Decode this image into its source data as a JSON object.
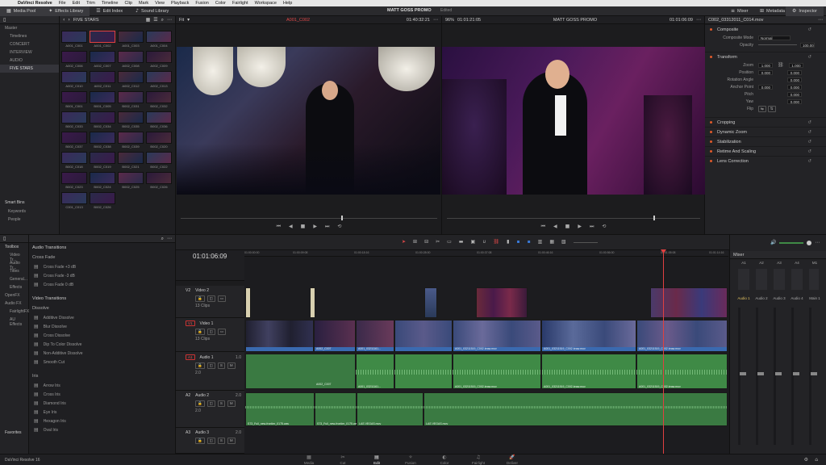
{
  "menubar": {
    "app": "DaVinci Resolve",
    "items": [
      "File",
      "Edit",
      "Trim",
      "Timeline",
      "Clip",
      "Mark",
      "View",
      "Playback",
      "Fusion",
      "Color",
      "Fairlight",
      "Workspace",
      "Help"
    ]
  },
  "toolbar": {
    "media_pool": "Media Pool",
    "effects_library": "Effects Library",
    "edit_index": "Edit Index",
    "sound_library": "Sound Library",
    "project_title": "MATT GOSS PROMO",
    "project_status": "Edited",
    "mixer": "Mixer",
    "metadata": "Metadata",
    "inspector": "Inspector"
  },
  "bins": {
    "header": "FIVE STARS",
    "master": "Master",
    "items": [
      "Timelines",
      "CONCERT",
      "INTERVIEW",
      "AUDIO",
      "FIVE STARS"
    ],
    "smart_bins": "Smart Bins",
    "smart_items": [
      "Keywords",
      "People"
    ]
  },
  "clips": [
    "A001_C001",
    "A001_C002",
    "A001_C003",
    "A001_C004",
    "A002_C006",
    "A002_C007",
    "A002_C008",
    "A002_C009",
    "A002_C010",
    "A002_C011",
    "A002_C012",
    "A002_C013",
    "B001_C001",
    "B001_C005",
    "B002_C031",
    "B002_C032",
    "B002_C033",
    "B002_C034",
    "B002_C035",
    "B002_C036",
    "B002_C037",
    "B002_C038",
    "B002_C039",
    "B002_C020",
    "B002_C018",
    "B002_C019",
    "B002_C021",
    "B002_C022",
    "B002_C023",
    "B002_C024",
    "B002_C025",
    "B002_C026",
    "C001_C013",
    "B002_C026"
  ],
  "source_viewer": {
    "zoom": "Fit",
    "clip": "A001_C002",
    "timecode": "01:40:32:21"
  },
  "timeline_viewer": {
    "zoom": "96%",
    "title": "MATT GOSS PROMO",
    "timecode": "01:01:21:05",
    "timecode2": "01:01:06:09"
  },
  "inspector": {
    "clip_name": "C002_03312011_C014.mov",
    "composite": "Composite",
    "composite_mode_label": "Composite Mode",
    "composite_mode": "Normal",
    "opacity_label": "Opacity",
    "opacity": "100.00",
    "transform": "Transform",
    "zoom_label": "Zoom",
    "zoom_x": "1.000",
    "zoom_y": "1.000",
    "position_label": "Position",
    "pos_x": "0.000",
    "pos_y": "0.000",
    "rotation_label": "Rotation Angle",
    "rotation": "0.000",
    "anchor_label": "Anchor Point",
    "anchor_x": "0.000",
    "anchor_y": "0.000",
    "pitch_label": "Pitch",
    "pitch": "0.000",
    "yaw_label": "Yaw",
    "yaw": "0.000",
    "flip_label": "Flip",
    "sections": [
      "Cropping",
      "Dynamic Zoom",
      "Stabilization",
      "Retime And Scaling",
      "Lens Correction"
    ]
  },
  "effects": {
    "toolbox": "Toolbox",
    "toolbox_items": [
      "Video Tr...",
      "Audio Tr...",
      "Titles",
      "General...",
      "Effects",
      "OpenFX",
      "Audio FX",
      "FairlightFX",
      "AU Effects"
    ],
    "audio_transitions": "Audio Transitions",
    "cross_fade": "Cross Fade",
    "audio_items": [
      "Cross Fade +3 dB",
      "Cross Fade -3 dB",
      "Cross Fade 0 dB"
    ],
    "video_transitions": "Video Transitions",
    "dissolve": "Dissolve",
    "video_items": [
      "Additive Dissolve",
      "Blur Dissolve",
      "Cross Dissolve",
      "Dip To Color Dissolve",
      "Non-Additive Dissolve",
      "Smooth Cut"
    ],
    "iris": "Iris",
    "iris_items": [
      "Arrow Iris",
      "Cross Iris",
      "Diamond Iris",
      "Eye Iris",
      "Hexagon Iris",
      "Oval Iris"
    ],
    "favorites": "Favorites"
  },
  "timeline": {
    "timecode": "01:01:06:09",
    "ruler": [
      "01:00:00:00",
      "01:00:09:08",
      "01:00:18:16",
      "01:00:28:00",
      "01:00:37:08",
      "01:00:46:16",
      "01:00:56:00",
      "01:01:05:08",
      "01:01:14:16"
    ],
    "tracks": [
      {
        "id": "V2",
        "name": "Video 2",
        "info": "13 Clips"
      },
      {
        "id": "V1",
        "name": "Video 1",
        "info": "13 Clips"
      },
      {
        "id": "A1",
        "name": "Audio 1",
        "info": "2.0",
        "ch": "1.0"
      },
      {
        "id": "A2",
        "name": "Audio 2",
        "info": "2.0",
        "ch": "2.0"
      },
      {
        "id": "A3",
        "name": "Audio 3",
        "info": "2.0",
        "ch": "2.0"
      }
    ],
    "v1_labels": [
      "A002_C007",
      "A001_03211161...",
      "A001_03211519_C002.braw.mov",
      "A001_03211519_C002.braw.mov",
      "A001_03211519_C002.braw.mov"
    ],
    "a1_labels": [
      "A002_C007",
      "A001_03211161...",
      "A001_03211519_C002.braw.mov",
      "A001_03211519_C002.braw.mov",
      "A001_03211519_C002.braw.mov"
    ],
    "a2_labels": [
      "S73_Full_new-frontier_0175.wav",
      "S73_Full_new-frontier_0175.wav",
      "LAS VEGAS.mov",
      "LAS VEGAS.mov"
    ]
  },
  "mixer": {
    "title": "Mixer",
    "channels": [
      "A1",
      "A2",
      "A3",
      "A4",
      "M1"
    ],
    "strips": [
      "Audio 1",
      "Audio 2",
      "Audio 3",
      "Audio 4",
      "Main 1"
    ]
  },
  "pages": {
    "items": [
      "Media",
      "Cut",
      "Edit",
      "Fusion",
      "Color",
      "Fairlight",
      "Deliver"
    ],
    "active": "Edit",
    "brand": "DaVinci Resolve 16"
  },
  "colors": {
    "accent": "#e0782e",
    "playhead": "#e04040",
    "video_clip": "#3a6ab0",
    "audio_clip": "#3f8a46"
  }
}
